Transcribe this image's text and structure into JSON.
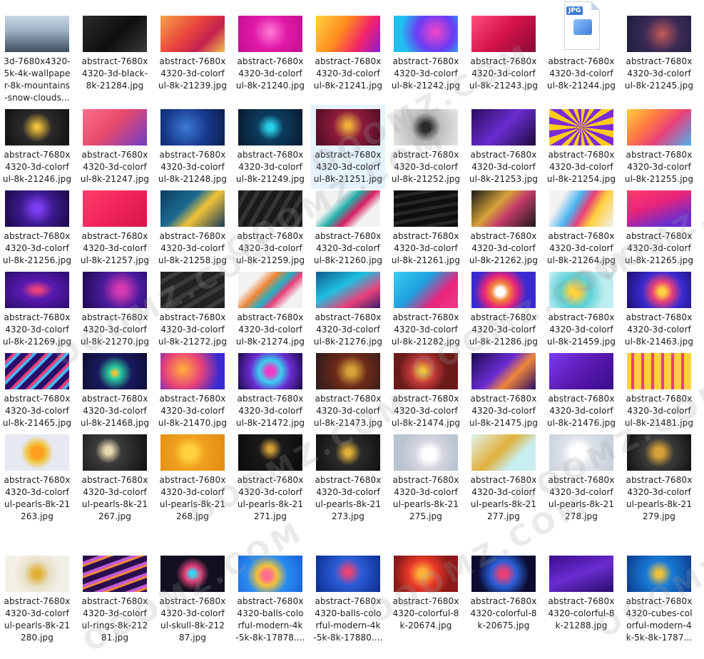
{
  "watermark_text": "OOOMZ.COM",
  "files": [
    {
      "label": "3d-7680x4320-\n5k-4k-wallpape\nr-8k-mountains\n-snow-clouds...",
      "thumb": "linear-gradient(180deg,#c9d6e4 0%,#9fb2c6 40%,#6d7f92 70%,#3f4c5a 100%)"
    },
    {
      "label": "abstract-7680x\n4320-3d-black-\n8k-21284.jpg",
      "thumb": "linear-gradient(135deg,#2b2b2b,#0e0e0e 55%,#3a3a3a)"
    },
    {
      "label": "abstract-7680x\n4320-3d-colorf\nul-8k-21239.jpg",
      "thumb": "linear-gradient(135deg,#f6a14a,#e8433d 45%,#c2224f 70%,#f3c04d)"
    },
    {
      "label": "abstract-7680x\n4320-3d-colorf\nul-8k-21240.jpg",
      "thumb": "radial-gradient(circle at 50% 45%,#ff7ad5,#e01aa8 45%,#c0108f)"
    },
    {
      "label": "abstract-7680x\n4320-3d-colorf\nul-8k-21241.jpg",
      "thumb": "linear-gradient(120deg,#ffd23d,#ff8a1f 40%,#f2236b 70%,#8c1bd6)"
    },
    {
      "label": "abstract-7680x\n4320-3d-colorf\nul-8k-21242.jpg",
      "thumb": "radial-gradient(circle at 65% 45%,#f547c9,#6a3cf3 40%,#1fc0f0 75%)"
    },
    {
      "label": "abstract-7680x\n4320-3d-colorf\nul-8k-21243.jpg",
      "thumb": "linear-gradient(135deg,#ff4f7b,#d3124b 50%,#8a0b35)"
    },
    {
      "label": "abstract-7680x\n4320-3d-colorf\nul-8k-21244.jpg",
      "thumb": "jpg-icon"
    },
    {
      "label": "abstract-7680x\n4320-3d-colorf\nul-8k-21245.jpg",
      "thumb": "radial-gradient(circle at 55% 50%,#c25a5a,#3b2a55 45%,#1c1f3d)"
    },
    {
      "label": "abstract-7680x\n4320-3d-colorf\nul-8k-21246.jpg",
      "thumb": "radial-gradient(circle at 50% 50%,#f0c23a 5%,#2a2a2a 40%,#111)"
    },
    {
      "label": "abstract-7680x\n4320-3d-colorf\nul-8k-21247.jpg",
      "thumb": "linear-gradient(135deg,#ff6f8e,#e84a6b 45%,#6e3cc8)"
    },
    {
      "label": "abstract-7680x\n4320-3d-colorf\nul-8k-21248.jpg",
      "thumb": "radial-gradient(circle at 40% 50%,#3f7bd8,#173a8c 50%,#0c1d4d)"
    },
    {
      "label": "abstract-7680x\n4320-3d-colorf\nul-8k-21249.jpg",
      "thumb": "radial-gradient(circle at 50% 50%,#2ad0e8 8%,#0d3c5e 35%,#081a2c)"
    },
    {
      "label": "abstract-7680x\n4320-3d-colorf\nul-8k-21251.jpg",
      "thumb": "radial-gradient(circle at 50% 45%,#f0b13a 6%,#8a1a3a 40%,#4a0d22)"
    },
    {
      "label": "abstract-7680x\n4320-3d-colorf\nul-8k-21252.jpg",
      "thumb": "radial-gradient(circle at 50% 50%,#2b2b2b 12%,#bdbdbd 40%,#e8e8e8)"
    },
    {
      "label": "abstract-7680x\n4320-3d-colorf\nul-8k-21253.jpg",
      "thumb": "linear-gradient(135deg,#2a0d5e,#6a2cd0 50%,#1c0a3d)"
    },
    {
      "label": "abstract-7680x\n4320-3d-colorf\nul-8k-21254.jpg",
      "thumb": "repeating-conic-gradient(from 0deg at 50% 50%,#ffcc1a 0deg 12deg,#7b2cd6 12deg 24deg)"
    },
    {
      "label": "abstract-7680x\n4320-3d-colorf\nul-8k-21255.jpg",
      "thumb": "linear-gradient(135deg,#ffcf3d,#ff7a45 35%,#e8417a 60%,#4ab3f0)"
    },
    {
      "label": "abstract-7680x\n4320-3d-colorf\nul-8k-21256.jpg",
      "thumb": "radial-gradient(circle at 50% 50%,#7b3cf0 10%,#3b1a8c 45%,#1a0a45)"
    },
    {
      "label": "abstract-7680x\n4320-3d-colorf\nul-8k-21257.jpg",
      "thumb": "linear-gradient(135deg,#ff3d6b,#f0245a 50%,#d61448)"
    },
    {
      "label": "abstract-7680x\n4320-3d-colorf\nul-8k-21258.jpg",
      "thumb": "linear-gradient(135deg,#0f3b5e,#1b6b8f 40%,#f0c23a 60%,#153a5a)"
    },
    {
      "label": "abstract-7680x\n4320-3d-colorf\nul-8k-21259.jpg",
      "thumb": "repeating-linear-gradient(120deg,#1a1a1a 0 8px,#333 8px 14px)"
    },
    {
      "label": "abstract-7680x\n4320-3d-colorf\nul-8k-21260.jpg",
      "thumb": "linear-gradient(135deg,#f2f2f2 30%,#1fb0a8 45%,#d61f5e 60%,#f2f2f2 75%)"
    },
    {
      "label": "abstract-7680x\n4320-3d-colorf\nul-8k-21261.jpg",
      "thumb": "repeating-linear-gradient(170deg,#0e0e0e 0 7px,#262626 7px 12px)"
    },
    {
      "label": "abstract-7680x\n4320-3d-colorf\nul-8k-21262.jpg",
      "thumb": "linear-gradient(135deg,#1a1a1a,#d6a13a 40%,#c23a6b 60%,#1a1a1a)"
    },
    {
      "label": "abstract-7680x\n4320-3d-colorf\nul-8k-21264.jpg",
      "thumb": "linear-gradient(120deg,#f2f2f2 20%,#4ab3f0 40%,#e8417a 55%,#ffcf3d 70%,#f2f2f2)"
    },
    {
      "label": "abstract-7680x\n4320-3d-colorf\nul-8k-21265.jpg",
      "thumb": "linear-gradient(160deg,#ff3d6b,#e8247a 40%,#6a2cd0 80%)"
    },
    {
      "label": "abstract-7680x\n4320-3d-colorf\nul-8k-21269.jpg",
      "thumb": "radial-gradient(ellipse at 50% 50%,#e8417a 8%,#5a1ab0 35%,#2a0d6b)"
    },
    {
      "label": "abstract-7680x\n4320-3d-colorf\nul-8k-21270.jpg",
      "thumb": "radial-gradient(circle at 60% 50%,#d63ab0 10%,#4a1a9c 45%,#1c0a4d)"
    },
    {
      "label": "abstract-7680x\n4320-3d-colorf\nul-8k-21272.jpg",
      "thumb": "repeating-linear-gradient(150deg,#222 0 10px,#3a3a3a 10px 16px)"
    },
    {
      "label": "abstract-7680x\n4320-3d-colorf\nul-8k-21274.jpg",
      "thumb": "linear-gradient(135deg,#f2f2f2 25%,#f0863a 40%,#1fb0c8 55%,#e8417a 65%,#f2f2f2 80%)"
    },
    {
      "label": "abstract-7680x\n4320-3d-colorf\nul-8k-21276.jpg",
      "thumb": "linear-gradient(150deg,#0d5a8c,#1fc0e0 40%,#e8417a 70%,#3a1a6b)"
    },
    {
      "label": "abstract-7680x\n4320-3d-colorf\nul-8k-21282.jpg",
      "thumb": "linear-gradient(135deg,#3ad0f0,#1fa0e0 40%,#e8247a 70%,#f03a8c)"
    },
    {
      "label": "abstract-7680x\n4320-3d-colorf\nul-8k-21286.jpg",
      "thumb": "radial-gradient(circle at 45% 55%,#ffffff 10%,#f0863a 22%,#e8247a 40%,#3a2ad0 65%)"
    },
    {
      "label": "abstract-7680x\n4320-3d-colorf\nul-8k-21459.jpg",
      "thumb": "radial-gradient(circle at 40% 55%,#ffd23d 10%,#5ad0d6 35%,#bfeef0 70%)"
    },
    {
      "label": "abstract-7680x\n4320-3d-colorf\nul-8k-21463.jpg",
      "thumb": "radial-gradient(circle at 55% 55%,#ffcf3d 8%,#e8417a 25%,#3a2ad0 50%,#1a0d6b)"
    },
    {
      "label": "abstract-7680x\n4320-3d-colorf\nul-8k-21465.jpg",
      "thumb": "repeating-linear-gradient(135deg,#2a0d6b 0 8px,#e8417a 8px 12px,#4ab3f0 12px 16px)"
    },
    {
      "label": "abstract-7680x\n4320-3d-colorf\nul-8k-21468.jpg",
      "thumb": "radial-gradient(circle at 50% 55%,#f0c23a 5%,#2ad0a0 15%,#1a1a5e 45%,#0c0c30)"
    },
    {
      "label": "abstract-7680x\n4320-3d-colorf\nul-8k-21470.jpg",
      "thumb": "radial-gradient(circle at 35% 45%,#ffb03a,#e8417a 40%,#3a2ad0 80%)"
    },
    {
      "label": "abstract-7680x\n4320-3d-colorf\nul-8k-21472.jpg",
      "thumb": "radial-gradient(circle at 50% 50%,#f03ac8 10%,#3ad0f0 30%,#6a2cd0 55%,#1a0a45)"
    },
    {
      "label": "abstract-7680x\n4320-3d-colorf\nul-8k-21473.jpg",
      "thumb": "radial-gradient(circle at 55% 50%,#d6a13a 10%,#6b2a1a 40%,#2a1a1a)"
    },
    {
      "label": "abstract-7680x\n4320-3d-colorf\nul-8k-21474.jpg",
      "thumb": "radial-gradient(circle at 45% 50%,#f0c23a 6%,#c23a3a 30%,#6b1a1a 60%)"
    },
    {
      "label": "abstract-7680x\n4320-3d-colorf\nul-8k-21475.jpg",
      "thumb": "linear-gradient(135deg,#1a0d4d,#6a2cd0 45%,#f0863a 65%,#2a0d6b)"
    },
    {
      "label": "abstract-7680x\n4320-3d-colorf\nul-8k-21476.jpg",
      "thumb": "linear-gradient(135deg,#7b3cf0,#5a1ab0 50%,#3b0d8c)"
    },
    {
      "label": "abstract-7680x\n4320-3d-colorf\nul-8k-21481.jpg",
      "thumb": "repeating-linear-gradient(90deg,#ffd23d 0 6px,#e8417a 6px 10px,#ffcf3d 10px 14px)"
    },
    {
      "label": "abstract-7680x\n4320-3d-colorf\nul-pearls-8k-21\n263.jpg",
      "thumb": "radial-gradient(circle at 50% 50%,#ff9f1f 15%,#f0c23a 25%,#e6e9f2 45%)"
    },
    {
      "label": "abstract-7680x\n4320-3d-colorf\nul-pearls-8k-21\n267.jpg",
      "thumb": "radial-gradient(circle at 40% 45%,#e8d8b0 8%,#3a3a3a 30%,#101010)"
    },
    {
      "label": "abstract-7680x\n4320-3d-colorf\nul-pearls-8k-21\n268.jpg",
      "thumb": "radial-gradient(circle at 45% 50%,#ffd23d 15%,#f0a01f 40%,#e08a10)"
    },
    {
      "label": "abstract-7680x\n4320-3d-colorf\nul-pearls-8k-21\n271.jpg",
      "thumb": "radial-gradient(circle at 50% 40%,#d6a13a 6%,#1a1a1a 30%,#0a0a0a)"
    },
    {
      "label": "abstract-7680x\n4320-3d-colorf\nul-pearls-8k-21\n273.jpg",
      "thumb": "radial-gradient(circle at 50% 50%,#e0b03a 8%,#2a2a2a 35%,#101010)"
    },
    {
      "label": "abstract-7680x\n4320-3d-colorf\nul-pearls-8k-21\n275.jpg",
      "thumb": "radial-gradient(circle at 55% 55%,#ffffff 15%,#d6d6e0 35%,#b8c4d0 70%)"
    },
    {
      "label": "abstract-7680x\n4320-3d-colorf\nul-pearls-8k-21\n277.jpg",
      "thumb": "linear-gradient(135deg,#dff3f0,#e0b03a 45%,#c8eef0 70%)"
    },
    {
      "label": "abstract-7680x\n4320-3d-colorf\nul-pearls-8k-21\n278.jpg",
      "thumb": "radial-gradient(circle at 45% 50%,#ffffff 18%,#dde2ea 40%,#c4ccd8)"
    },
    {
      "label": "abstract-7680x\n4320-3d-colorf\nul-pearls-8k-21\n279.jpg",
      "thumb": "radial-gradient(circle at 50% 50%,#d6a13a 12%,#3a3a3a 40%,#101010)"
    },
    {
      "label": "abstract-7680x\n4320-3d-colorf\nul-pearls-8k-21\n280.jpg",
      "thumb": "radial-gradient(circle at 50% 50%,#e0b03a 10%,#e8e0c8 35%,#f2efe6 65%)"
    },
    {
      "label": "abstract-7680x\n4320-3d-colorf\nul-rings-8k-212\n81.jpg",
      "thumb": "repeating-linear-gradient(160deg,#2a0d4d 0 8px,#c25ad6 8px 12px,#f0863a 12px 15px)"
    },
    {
      "label": "abstract-7680x\n4320-3d-colorf\nul-skull-8k-212\n87.jpg",
      "thumb": "radial-gradient(circle at 50% 50%,#3ad0f0 8%,#e8417a 20%,#101020 45%)"
    },
    {
      "label": "abstract-7680x\n4320-balls-colo\nrful-modern-4k\n-5k-8k-17878....",
      "thumb": "radial-gradient(circle at 45% 55%,#ff6f8e 10%,#f0c23a 25%,#2a8cf0 50%,#1a5ed6)"
    },
    {
      "label": "abstract-7680x\n4320-balls-colo\nrful-modern-4k\n-5k-8k-17880....",
      "thumb": "radial-gradient(circle at 50% 45%,#e8417a 8%,#2a5ed6 35%,#0c2a8c)"
    },
    {
      "label": "abstract-7680x\n4320-colorful-8\nk-20674.jpg",
      "thumb": "radial-gradient(circle at 45% 50%,#ffb03a 10%,#e83a2a 35%,#8c1a1a 70%)"
    },
    {
      "label": "abstract-7680x\n4320-colorful-8\nk-20675.jpg",
      "thumb": "radial-gradient(circle at 50% 50%,#e8417a 10%,#2a5ed6 35%,#0c0c30 70%)"
    },
    {
      "label": "abstract-7680x\n4320-colorful-8\nk-21288.jpg",
      "thumb": "linear-gradient(160deg,#3b0d8c,#6a2cd0 50%,#2a0d6b)"
    },
    {
      "label": "abstract-7680x\n4320-cubes-col\norful-modern-4\nk-5k-8k-1787...",
      "thumb": "radial-gradient(circle at 50% 50%,#f0c23a 8%,#1a7bd6 35%,#0c3a8c)"
    }
  ],
  "selected_index": 13
}
